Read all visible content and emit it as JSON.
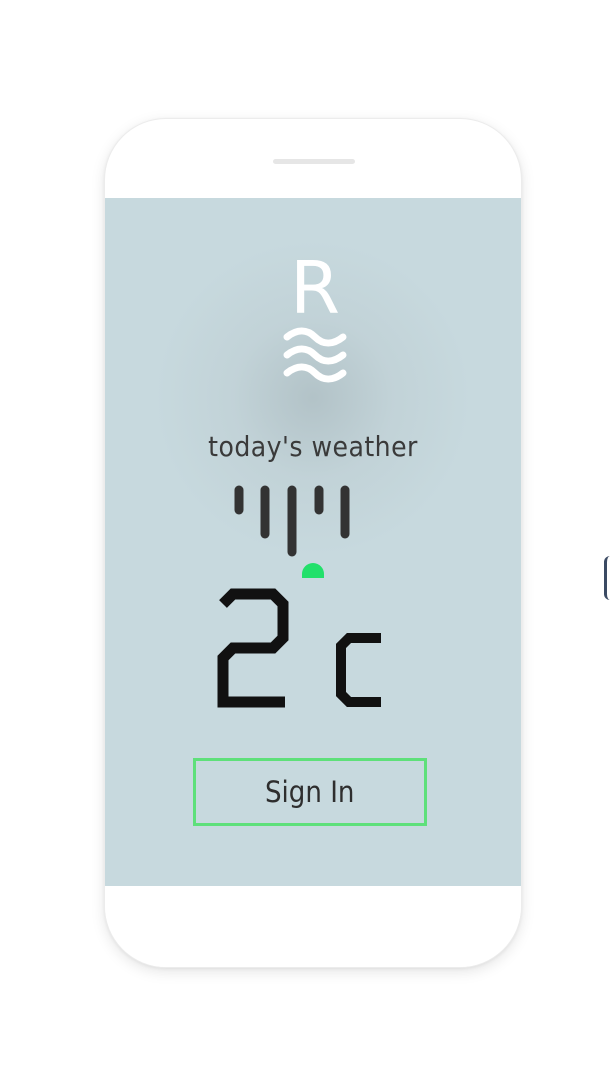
{
  "app": {
    "logo_letter": "R",
    "subtitle": "today's weather"
  },
  "weather": {
    "temperature": "2",
    "unit": "c"
  },
  "actions": {
    "signin_label": "Sign In"
  },
  "colors": {
    "screen_bg": "#c7d9de",
    "accent_green": "#5ee07a",
    "indicator_green": "#22e06a",
    "text_dark": "#2e2e2e",
    "bars_dark": "#333333"
  },
  "icons": {
    "logo": "r-waves-logo-icon",
    "gauge": "weather-gauge-icon"
  }
}
